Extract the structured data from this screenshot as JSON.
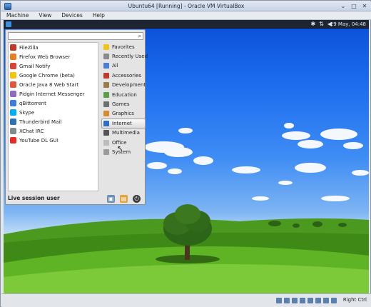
{
  "window": {
    "title": "Ubuntu64 [Running] - Oracle VM VirtualBox",
    "controls": [
      "⌄",
      "□",
      "✕"
    ]
  },
  "menubar": [
    "Machine",
    "View",
    "Devices",
    "Help"
  ],
  "guest_panel": {
    "tray_icons": [
      "bluetooth-icon",
      "network-icon",
      "volume-icon"
    ],
    "tray_glyphs": [
      "✱",
      "⇅",
      "◀"
    ],
    "clock": "29 May, 04:48"
  },
  "search": {
    "value": "",
    "placeholder": ""
  },
  "apps": [
    {
      "label": "FileZilla",
      "color": "#c0392b"
    },
    {
      "label": "Firefox Web Browser",
      "color": "#e67e22"
    },
    {
      "label": "Gmail Notify",
      "color": "#d44638"
    },
    {
      "label": "Google Chrome (beta)",
      "color": "#f1c40f"
    },
    {
      "label": "Oracle Java 8 Web Start",
      "color": "#e0573a"
    },
    {
      "label": "Pidgin Internet Messenger",
      "color": "#8e6bbf"
    },
    {
      "label": "qBittorrent",
      "color": "#3b7dd8"
    },
    {
      "label": "Skype",
      "color": "#00aff0"
    },
    {
      "label": "Thunderbird Mail",
      "color": "#2f6fb3"
    },
    {
      "label": "XChat IRC",
      "color": "#7f8c8d"
    },
    {
      "label": "YouTube DL GUI",
      "color": "#e52d27"
    }
  ],
  "categories": [
    {
      "label": "Favorites",
      "color": "#f0c419"
    },
    {
      "label": "Recently Used",
      "color": "#8a8a8a"
    },
    {
      "label": "All",
      "color": "#4a7fd4"
    },
    {
      "label": "Accessories",
      "color": "#c0392b"
    },
    {
      "label": "Development",
      "color": "#9b7b4a"
    },
    {
      "label": "Education",
      "color": "#5a9e46"
    },
    {
      "label": "Games",
      "color": "#6f6f6f"
    },
    {
      "label": "Graphics",
      "color": "#d88b2c"
    },
    {
      "label": "Internet",
      "color": "#2e6ec9"
    },
    {
      "label": "Multimedia",
      "color": "#555555"
    },
    {
      "label": "Office",
      "color": "#bdbdbd"
    },
    {
      "label": "System",
      "color": "#9a9a9a"
    }
  ],
  "hovered_category": "Internet",
  "session_label": "Live session user",
  "menu_actions": [
    "lock-screen-icon",
    "logout-icon",
    "shutdown-icon"
  ],
  "status_bar": {
    "host_key": "Right Ctrl"
  }
}
